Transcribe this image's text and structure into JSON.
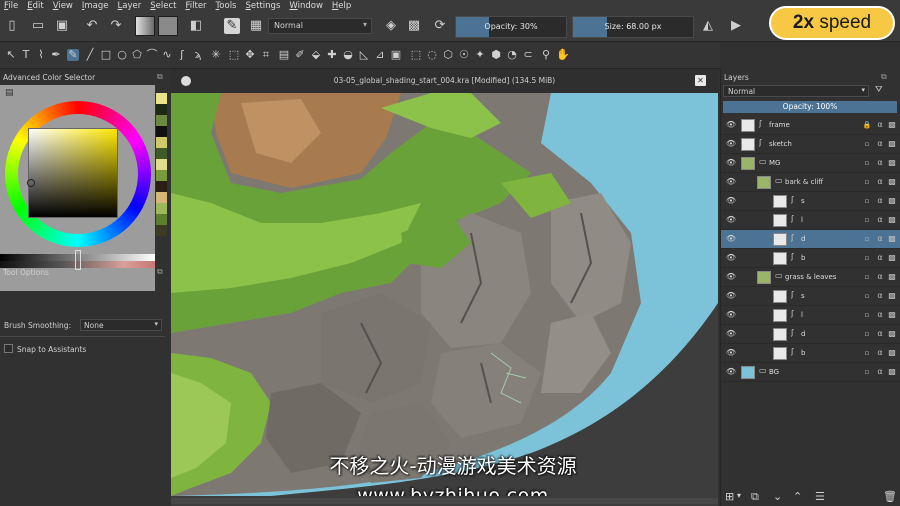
{
  "menu": [
    "File",
    "Edit",
    "View",
    "Image",
    "Layer",
    "Select",
    "Filter",
    "Tools",
    "Settings",
    "Window",
    "Help"
  ],
  "toolbar": {
    "blend_mode": "Normal",
    "opacity_label": "Opacity: 30%",
    "opacity_value": 0.3,
    "size_label": "Size:",
    "size_value": "68.00 px",
    "size_fill": 0.28
  },
  "speed_badge": {
    "value": "2x",
    "text": "speed"
  },
  "left_dock": {
    "color_selector_title": "Advanced Color Selector",
    "tool_options_title": "Tool Options",
    "brush_smoothing_label": "Brush Smoothing:",
    "brush_smoothing_value": "None",
    "snap_label": "Snap to Assistants",
    "palette": [
      "#e9e38a",
      "#1c2a14",
      "#6a8a3e",
      "#111111",
      "#cfc96a",
      "#3f5a26",
      "#e2dc8a",
      "#7a9a3c",
      "#2b1f14",
      "#d6b874",
      "#9cb85a",
      "#5b7f2c",
      "#3c3a22"
    ]
  },
  "canvas": {
    "title": "03-05_global_shading_start_004.kra [Modified]  (134.5 MiB)"
  },
  "watermark": {
    "line1": "不移之火-动漫游戏美术资源",
    "line2": "www.byzhihuo.com"
  },
  "layers_dock": {
    "title": "Layers",
    "blend_mode": "Normal",
    "opacity_label": "Opacity:  100%",
    "layers": [
      {
        "name": "frame",
        "indent": 0,
        "type": "paint",
        "locked": true,
        "selected": false
      },
      {
        "name": "sketch",
        "indent": 0,
        "type": "paint",
        "locked": false,
        "selected": false
      },
      {
        "name": "MG",
        "indent": 0,
        "type": "group",
        "locked": false,
        "selected": false
      },
      {
        "name": "bark & cliff",
        "indent": 1,
        "type": "group",
        "locked": false,
        "selected": false
      },
      {
        "name": "s",
        "indent": 2,
        "type": "paint",
        "locked": false,
        "selected": false
      },
      {
        "name": "l",
        "indent": 2,
        "type": "paint",
        "locked": false,
        "selected": false
      },
      {
        "name": "d",
        "indent": 2,
        "type": "paint",
        "locked": false,
        "selected": true
      },
      {
        "name": "b",
        "indent": 2,
        "type": "paint",
        "locked": false,
        "selected": false
      },
      {
        "name": "grass & leaves",
        "indent": 1,
        "type": "group",
        "locked": false,
        "selected": false
      },
      {
        "name": "s",
        "indent": 2,
        "type": "paint",
        "locked": false,
        "selected": false
      },
      {
        "name": "l",
        "indent": 2,
        "type": "paint",
        "locked": false,
        "selected": false
      },
      {
        "name": "d",
        "indent": 2,
        "type": "paint",
        "locked": false,
        "selected": false
      },
      {
        "name": "b",
        "indent": 2,
        "type": "paint",
        "locked": false,
        "selected": false
      },
      {
        "name": "BG",
        "indent": 0,
        "type": "group",
        "locked": false,
        "selected": false
      }
    ]
  }
}
